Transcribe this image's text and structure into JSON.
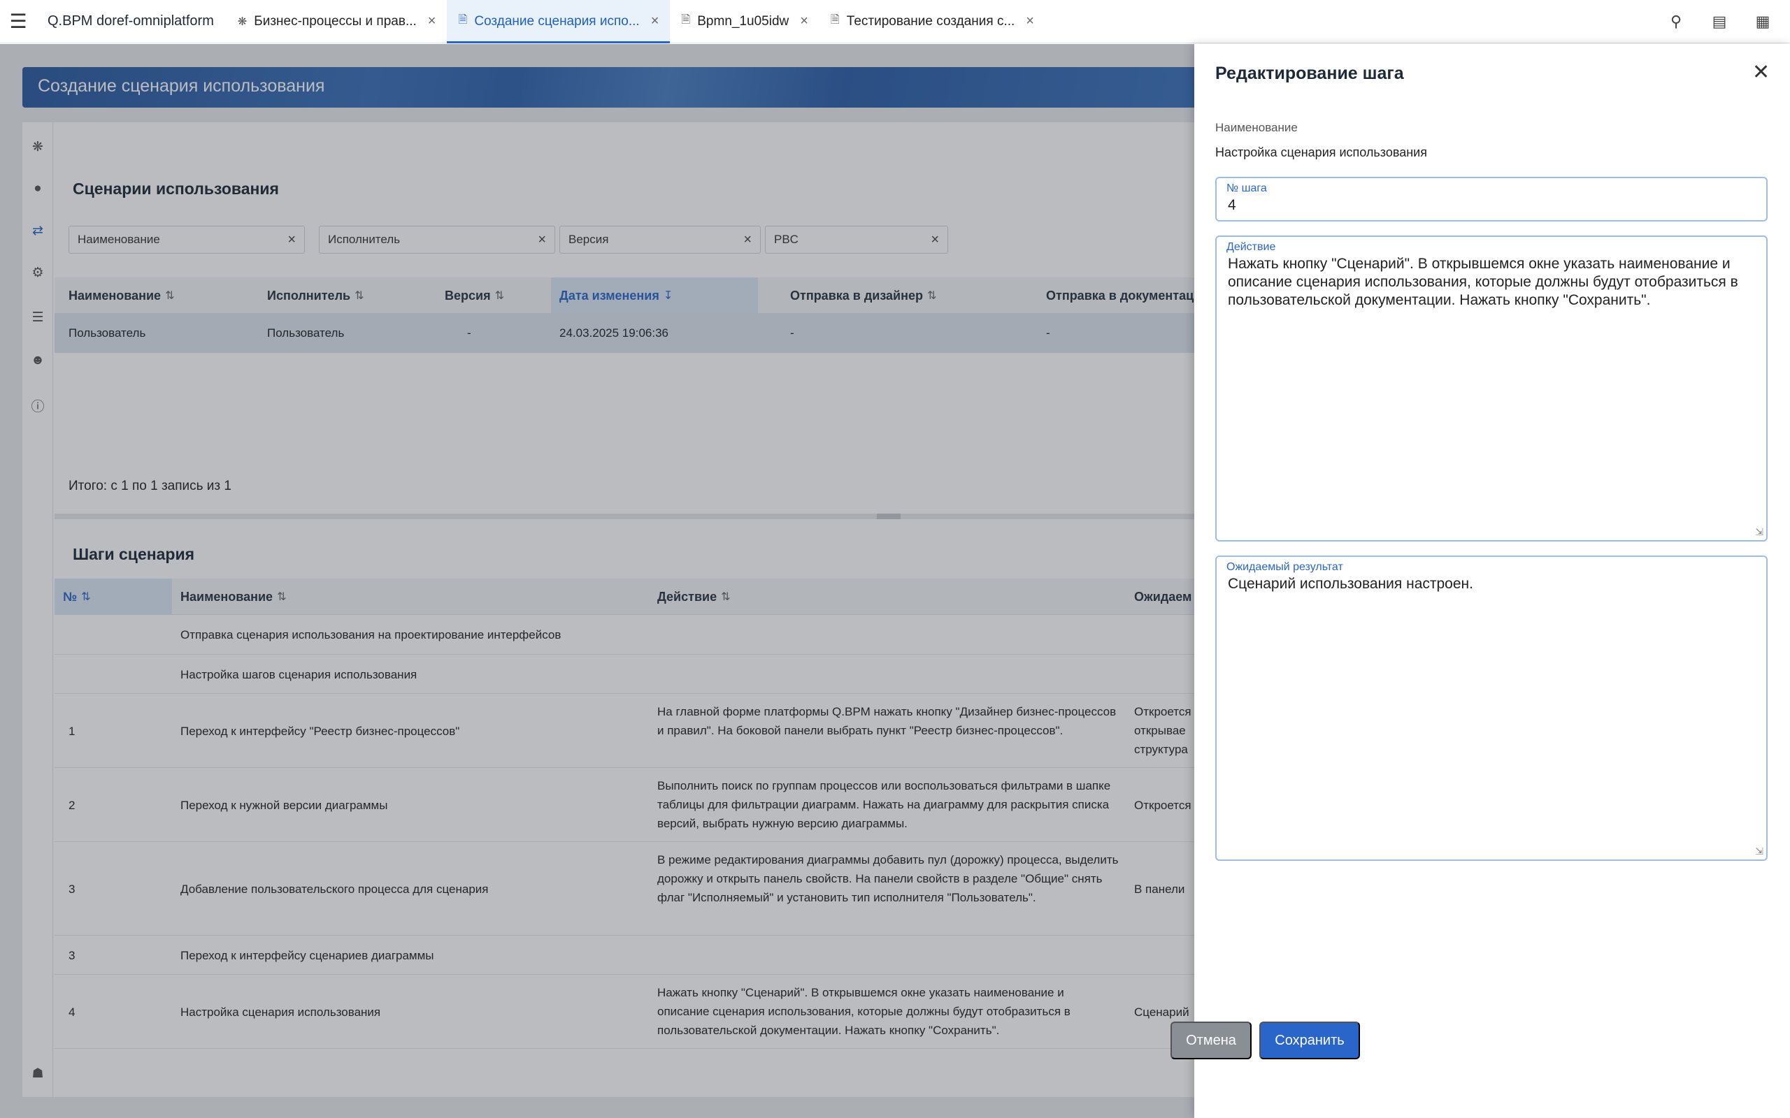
{
  "app_title": "Q.BPM doref-omniplatform",
  "tabs": [
    {
      "label": "Бизнес-процессы и прав...",
      "icon": "process-icon",
      "active": false
    },
    {
      "label": "Создание сценария испо...",
      "icon": "document-icon",
      "active": true
    },
    {
      "label": "Bpmn_1u05idw",
      "icon": "document-icon",
      "active": false
    },
    {
      "label": "Тестирование создания с...",
      "icon": "document-icon",
      "active": false
    }
  ],
  "page_header": "Создание сценария использования",
  "scenarios": {
    "title": "Сценарии использования",
    "filters": [
      "Наименование",
      "Исполнитель",
      "Версия",
      "PBC"
    ],
    "columns": [
      "Наименование",
      "Исполнитель",
      "Версия",
      "Дата изменения",
      "Отправка в дизайнер",
      "Отправка в документацию"
    ],
    "rows": [
      [
        "Пользователь",
        "Пользователь",
        "-",
        "24.03.2025 19:06:36",
        "-",
        "-"
      ]
    ],
    "total": "Итого: с 1 по 1 запись из 1"
  },
  "steps": {
    "title": "Шаги сценария",
    "columns": [
      "№",
      "Наименование",
      "Действие",
      "Ожидаем"
    ],
    "rows": [
      {
        "num": "",
        "name": "Отправка сценария использования на проектирование интерфейсов",
        "action": "",
        "result": ""
      },
      {
        "num": "",
        "name": "Настройка шагов сценария использования",
        "action": "",
        "result": ""
      },
      {
        "num": "1",
        "name": "Переход к интерфейсу \"Реестр бизнес-процессов\"",
        "action": "На главной форме платформы Q.BPM нажать кнопку \"Дизайнер бизнес-процессов и правил\". На боковой панели выбрать пункт \"Реестр бизнес-процессов\".",
        "result": "Откроется открывае структура"
      },
      {
        "num": "2",
        "name": "Переход к нужной версии диаграммы",
        "action": "Выполнить поиск по группам процессов или воспользоваться фильтрами в шапке таблицы для фильтрации диаграмм. Нажать на диаграмму для раскрытия списка версий, выбрать нужную версию диаграммы.",
        "result": "Откроется"
      },
      {
        "num": "3",
        "name": "Добавление пользовательского процесса для сценария",
        "action": "В режиме редактирования диаграммы добавить пул (дорожку) процесса, выделить дорожку и открыть панель свойств. На панели свойств в разделе \"Общие\" снять флаг \"Исполняемый\" и установить тип исполнителя \"Пользователь\".",
        "result": "В панели"
      },
      {
        "num": "3",
        "name": "Переход к интерфейсу сценариев диаграммы",
        "action": "",
        "result": ""
      },
      {
        "num": "4",
        "name": "Настройка сценария использования",
        "action": "Нажать кнопку \"Сценарий\". В открывшемся окне указать наименование и описание сценария использования, которые должны будут отобразиться в пользовательской документации. Нажать кнопку \"Сохранить\".",
        "result": "Сценарий"
      }
    ]
  },
  "panel": {
    "title": "Редактирование шага",
    "name_label": "Наименование",
    "name_value": "Настройка сценария использования",
    "step_label": "№ шага",
    "step_value": "4",
    "action_label": "Действие",
    "action_value": "Нажать кнопку \"Сценарий\". В открывшемся окне указать наименование и описание сценария использования, которые должны будут отобразиться в пользовательской документации. Нажать кнопку \"Сохранить\".",
    "result_label": "Ожидаемый результат",
    "result_value": "Сценарий использования настроен.",
    "cancel_label": "Отмена",
    "save_label": "Сохранить"
  },
  "colors": {
    "accent": "#2a66c9",
    "header": "#2b5aa0",
    "cancel": "#8a8f95"
  }
}
